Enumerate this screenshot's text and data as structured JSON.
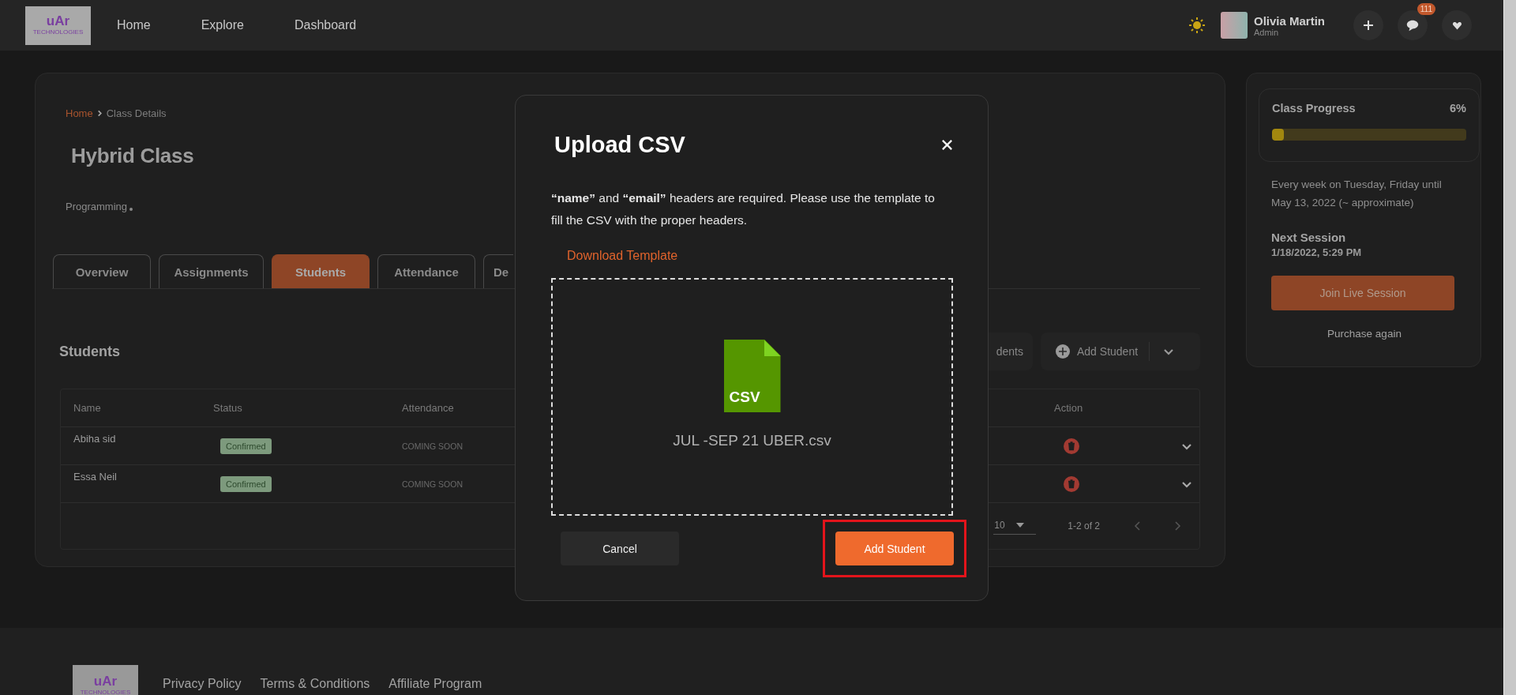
{
  "header": {
    "logo": {
      "mark": "uAr",
      "caption": "TECHNOLOGIES"
    },
    "nav": [
      {
        "label": "Home"
      },
      {
        "label": "Explore"
      },
      {
        "label": "Dashboard"
      }
    ],
    "user": {
      "name": "Olivia Martin",
      "role": "Admin"
    },
    "notifications": "111"
  },
  "breadcrumb": [
    {
      "label": "Home",
      "kind": "link"
    },
    {
      "label": "Class Details",
      "kind": "current"
    }
  ],
  "class": {
    "title": "Hybrid Class",
    "category": "Programming"
  },
  "tabs": [
    {
      "label": "Overview",
      "selected": false
    },
    {
      "label": "Assignments",
      "selected": false
    },
    {
      "label": "Students",
      "selected": true
    },
    {
      "label": "Attendance",
      "selected": false
    },
    {
      "label": "De",
      "selected": false
    }
  ],
  "students": {
    "heading": "Students",
    "actions": [
      {
        "label": "dents",
        "kind": "plain"
      },
      {
        "label": "Add Student",
        "kind": "split"
      }
    ],
    "columns": [
      "Name",
      "Status",
      "Attendance",
      "Action"
    ],
    "rows": [
      {
        "name": "Abiha sid",
        "status": "Confirmed",
        "attendance": "COMING SOON"
      },
      {
        "name": "Essa Neil",
        "status": "Confirmed",
        "attendance": "COMING SOON"
      }
    ],
    "pagination": {
      "per_page": "10",
      "range": "1-2 of 2"
    }
  },
  "progress": {
    "title": "Class Progress",
    "percent": "6%",
    "level": 0.06,
    "schedule": "Every week on Tuesday, Friday until May 13, 2022 (~ approximate)",
    "next_label": "Next Session",
    "next_time": "1/18/2022, 5:29 PM",
    "join": "Join Live Session",
    "purchase": "Purchase again"
  },
  "modal": {
    "title": "Upload CSV",
    "instructions": "**“name”** and **“email”** headers are required. Please use the template to fill the CSV with the proper headers.",
    "template_link": "Download Template",
    "file_badge": "CSV",
    "file_name": "JUL -SEP 21 UBER.csv",
    "buttons": [
      {
        "label": "Cancel",
        "kind": "secondary",
        "highlighted": false
      },
      {
        "label": "Add Student",
        "kind": "primary",
        "highlighted": true
      }
    ]
  },
  "footer": {
    "logo": {
      "mark": "uAr",
      "caption": "TECHNOLOGIES"
    },
    "links": [
      {
        "label": "Privacy Policy"
      },
      {
        "label": "Terms & Conditions"
      },
      {
        "label": "Affiliate Program"
      }
    ]
  }
}
